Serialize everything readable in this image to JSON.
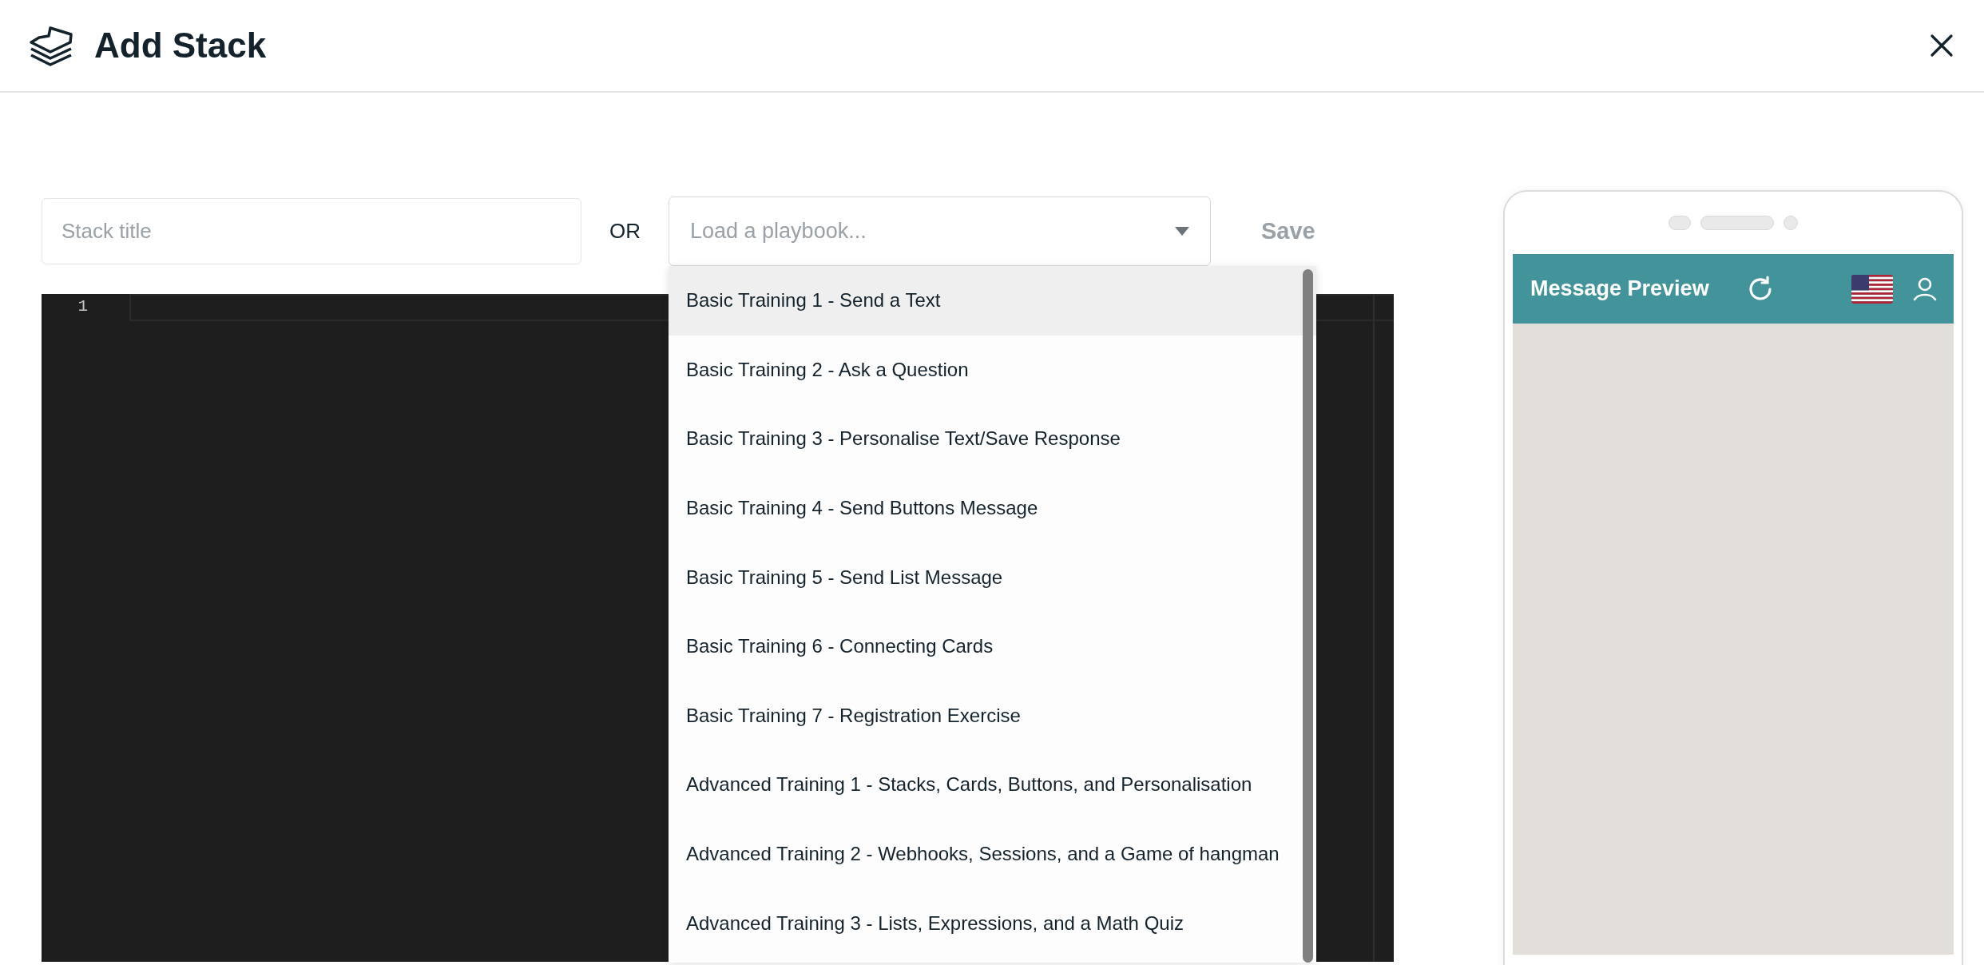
{
  "header": {
    "title": "Add Stack"
  },
  "form": {
    "stack_title": {
      "placeholder": "Stack title"
    },
    "separator": "OR",
    "playbook_select": {
      "placeholder": "Load a playbook...",
      "expanded": true
    },
    "save_button": {
      "label": "Save",
      "disabled": true
    }
  },
  "editor": {
    "line_numbers": [
      "1"
    ]
  },
  "playbook_options": [
    {
      "label": "Basic Training 1 - Send a Text",
      "selected": true
    },
    {
      "label": "Basic Training 2 - Ask a Question",
      "selected": false
    },
    {
      "label": "Basic Training 3 - Personalise Text/Save Response",
      "selected": false
    },
    {
      "label": "Basic Training 4 - Send Buttons Message",
      "selected": false
    },
    {
      "label": "Basic Training 5 - Send List Message",
      "selected": false
    },
    {
      "label": "Basic Training 6 - Connecting Cards",
      "selected": false
    },
    {
      "label": "Basic Training 7 - Registration Exercise",
      "selected": false
    },
    {
      "label": "Advanced Training 1 - Stacks, Cards, Buttons, and Personalisation",
      "selected": false
    },
    {
      "label": "Advanced Training 2 - Webhooks, Sessions, and a Game of hangman",
      "selected": false
    },
    {
      "label": "Advanced Training 3 - Lists, Expressions, and a Math Quiz",
      "selected": false
    }
  ],
  "preview": {
    "title": "Message Preview"
  }
}
